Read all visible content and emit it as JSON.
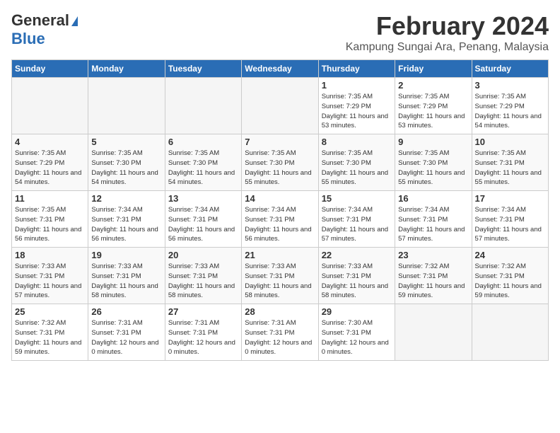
{
  "logo": {
    "general": "General",
    "blue": "Blue"
  },
  "title": "February 2024",
  "location": "Kampung Sungai Ara, Penang, Malaysia",
  "headers": [
    "Sunday",
    "Monday",
    "Tuesday",
    "Wednesday",
    "Thursday",
    "Friday",
    "Saturday"
  ],
  "weeks": [
    [
      {
        "day": "",
        "info": ""
      },
      {
        "day": "",
        "info": ""
      },
      {
        "day": "",
        "info": ""
      },
      {
        "day": "",
        "info": ""
      },
      {
        "day": "1",
        "sunrise": "7:35 AM",
        "sunset": "7:29 PM",
        "daylight": "11 hours and 53 minutes."
      },
      {
        "day": "2",
        "sunrise": "7:35 AM",
        "sunset": "7:29 PM",
        "daylight": "11 hours and 53 minutes."
      },
      {
        "day": "3",
        "sunrise": "7:35 AM",
        "sunset": "7:29 PM",
        "daylight": "11 hours and 54 minutes."
      }
    ],
    [
      {
        "day": "4",
        "sunrise": "7:35 AM",
        "sunset": "7:29 PM",
        "daylight": "11 hours and 54 minutes."
      },
      {
        "day": "5",
        "sunrise": "7:35 AM",
        "sunset": "7:30 PM",
        "daylight": "11 hours and 54 minutes."
      },
      {
        "day": "6",
        "sunrise": "7:35 AM",
        "sunset": "7:30 PM",
        "daylight": "11 hours and 54 minutes."
      },
      {
        "day": "7",
        "sunrise": "7:35 AM",
        "sunset": "7:30 PM",
        "daylight": "11 hours and 55 minutes."
      },
      {
        "day": "8",
        "sunrise": "7:35 AM",
        "sunset": "7:30 PM",
        "daylight": "11 hours and 55 minutes."
      },
      {
        "day": "9",
        "sunrise": "7:35 AM",
        "sunset": "7:30 PM",
        "daylight": "11 hours and 55 minutes."
      },
      {
        "day": "10",
        "sunrise": "7:35 AM",
        "sunset": "7:31 PM",
        "daylight": "11 hours and 55 minutes."
      }
    ],
    [
      {
        "day": "11",
        "sunrise": "7:35 AM",
        "sunset": "7:31 PM",
        "daylight": "11 hours and 56 minutes."
      },
      {
        "day": "12",
        "sunrise": "7:34 AM",
        "sunset": "7:31 PM",
        "daylight": "11 hours and 56 minutes."
      },
      {
        "day": "13",
        "sunrise": "7:34 AM",
        "sunset": "7:31 PM",
        "daylight": "11 hours and 56 minutes."
      },
      {
        "day": "14",
        "sunrise": "7:34 AM",
        "sunset": "7:31 PM",
        "daylight": "11 hours and 56 minutes."
      },
      {
        "day": "15",
        "sunrise": "7:34 AM",
        "sunset": "7:31 PM",
        "daylight": "11 hours and 57 minutes."
      },
      {
        "day": "16",
        "sunrise": "7:34 AM",
        "sunset": "7:31 PM",
        "daylight": "11 hours and 57 minutes."
      },
      {
        "day": "17",
        "sunrise": "7:34 AM",
        "sunset": "7:31 PM",
        "daylight": "11 hours and 57 minutes."
      }
    ],
    [
      {
        "day": "18",
        "sunrise": "7:33 AM",
        "sunset": "7:31 PM",
        "daylight": "11 hours and 57 minutes."
      },
      {
        "day": "19",
        "sunrise": "7:33 AM",
        "sunset": "7:31 PM",
        "daylight": "11 hours and 58 minutes."
      },
      {
        "day": "20",
        "sunrise": "7:33 AM",
        "sunset": "7:31 PM",
        "daylight": "11 hours and 58 minutes."
      },
      {
        "day": "21",
        "sunrise": "7:33 AM",
        "sunset": "7:31 PM",
        "daylight": "11 hours and 58 minutes."
      },
      {
        "day": "22",
        "sunrise": "7:33 AM",
        "sunset": "7:31 PM",
        "daylight": "11 hours and 58 minutes."
      },
      {
        "day": "23",
        "sunrise": "7:32 AM",
        "sunset": "7:31 PM",
        "daylight": "11 hours and 59 minutes."
      },
      {
        "day": "24",
        "sunrise": "7:32 AM",
        "sunset": "7:31 PM",
        "daylight": "11 hours and 59 minutes."
      }
    ],
    [
      {
        "day": "25",
        "sunrise": "7:32 AM",
        "sunset": "7:31 PM",
        "daylight": "11 hours and 59 minutes."
      },
      {
        "day": "26",
        "sunrise": "7:31 AM",
        "sunset": "7:31 PM",
        "daylight": "12 hours and 0 minutes."
      },
      {
        "day": "27",
        "sunrise": "7:31 AM",
        "sunset": "7:31 PM",
        "daylight": "12 hours and 0 minutes."
      },
      {
        "day": "28",
        "sunrise": "7:31 AM",
        "sunset": "7:31 PM",
        "daylight": "12 hours and 0 minutes."
      },
      {
        "day": "29",
        "sunrise": "7:30 AM",
        "sunset": "7:31 PM",
        "daylight": "12 hours and 0 minutes."
      },
      {
        "day": "",
        "info": ""
      },
      {
        "day": "",
        "info": ""
      }
    ]
  ]
}
